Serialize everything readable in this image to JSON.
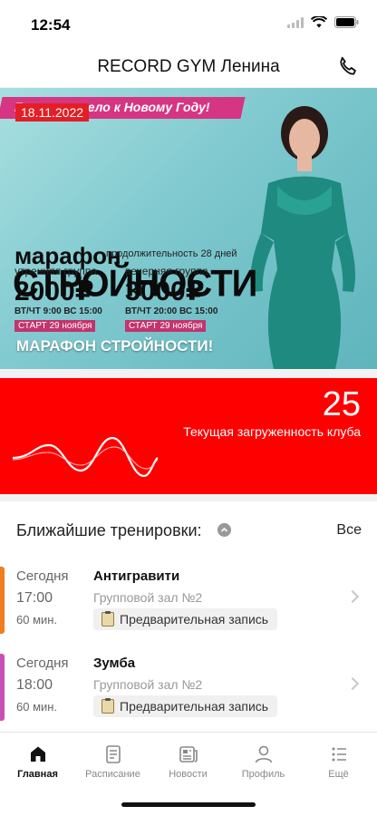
{
  "status_bar": {
    "time": "12:54"
  },
  "header": {
    "title": "RECORD GYM Ленина",
    "phone_icon": "phone-icon"
  },
  "banner": {
    "ribbon": "Готовим тело к Новому Году!",
    "date": "18.11.2022",
    "line1": "марафон",
    "duration": "продолжительность 28 дней",
    "line2": "СТРОЙНОСТИ",
    "groups": [
      {
        "name": "утренняя группа",
        "price": "2000₽",
        "time": "ВТ/ЧТ 9:00  ВС 15:00",
        "start": "СТАРТ 29 ноября"
      },
      {
        "name": "вечерняя группа",
        "price": "3000₽",
        "time": "ВТ/ЧТ 20:00  ВС 15:00",
        "start": "СТАРТ 29 ноября"
      }
    ],
    "caption": "МАРАФОН СТРОЙНОСТИ!"
  },
  "load": {
    "value": "25",
    "label": "Текущая загруженность клуба"
  },
  "trainings": {
    "title": "Ближайшие тренировки:",
    "all": "Все",
    "items": [
      {
        "day": "Сегодня",
        "time": "17:00",
        "duration": "60 мин.",
        "name": "Антигравити",
        "room": "Групповой зал №2",
        "tag": "Предварительная запись",
        "accent": "#f07d1f"
      },
      {
        "day": "Сегодня",
        "time": "18:00",
        "duration": "60 мин.",
        "name": "Зумба",
        "room": "Групповой зал №2",
        "tag": "Предварительная запись",
        "accent": "#c94fb4"
      }
    ]
  },
  "tabbar": {
    "items": [
      {
        "label": "Главная",
        "icon": "home-icon",
        "active": true
      },
      {
        "label": "Расписание",
        "icon": "schedule-icon",
        "active": false
      },
      {
        "label": "Новости",
        "icon": "news-icon",
        "active": false
      },
      {
        "label": "Профиль",
        "icon": "profile-icon",
        "active": false
      },
      {
        "label": "Ещё",
        "icon": "more-icon",
        "active": false
      }
    ]
  },
  "colors": {
    "brand_red": "#ff0000",
    "date_badge": "#e31e24"
  }
}
